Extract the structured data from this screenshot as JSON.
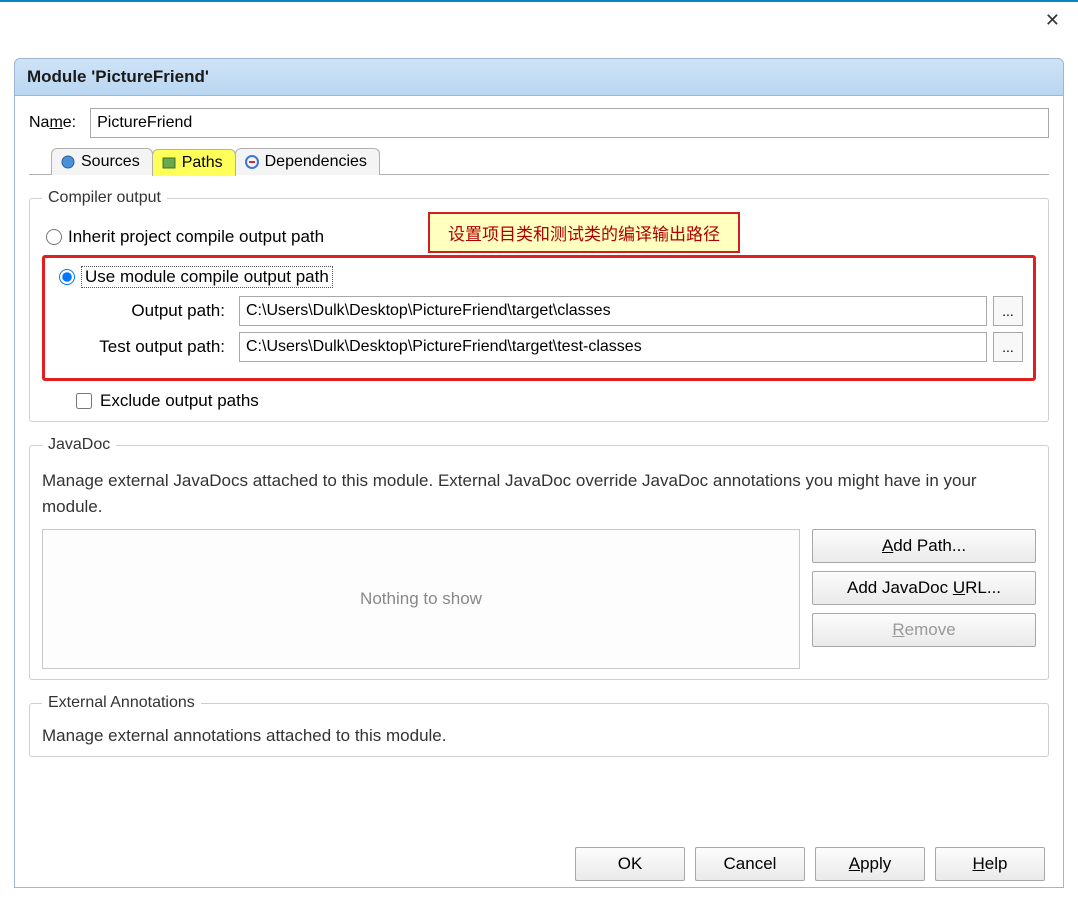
{
  "dialog": {
    "title": "Module 'PictureFriend'",
    "name_label_pre": "Na",
    "name_label_u": "m",
    "name_label_post": "e:",
    "name_value": "PictureFriend"
  },
  "tabs": {
    "sources": "Sources",
    "paths": "Paths",
    "dependencies": "Dependencies"
  },
  "compiler": {
    "legend": "Compiler output",
    "inherit_label": "Inherit project compile output path",
    "use_module_label": "Use module compile output path",
    "output_label": "Output path:",
    "output_value": "C:\\Users\\Dulk\\Desktop\\PictureFriend\\target\\classes",
    "test_label": "Test output path:",
    "test_value": "C:\\Users\\Dulk\\Desktop\\PictureFriend\\target\\test-classes",
    "browse": "...",
    "exclude_label": "Exclude output paths",
    "annotation": "设置项目类和测试类的编译输出路径"
  },
  "javadoc": {
    "legend": "JavaDoc",
    "body": "Manage external JavaDocs attached to this module. External JavaDoc override JavaDoc annotations you might have in your module.",
    "nothing": "Nothing to show",
    "add_path_pre": "",
    "add_path_u": "A",
    "add_path_post": "dd Path...",
    "add_url_pre": "Add JavaDoc ",
    "add_url_u": "U",
    "add_url_post": "RL...",
    "remove_pre": "",
    "remove_u": "R",
    "remove_post": "emove"
  },
  "external": {
    "legend": "External Annotations",
    "body": "Manage external annotations attached to this module."
  },
  "buttons": {
    "ok": "OK",
    "cancel": "Cancel",
    "apply_pre": "",
    "apply_u": "A",
    "apply_post": "pply",
    "help_pre": "",
    "help_u": "H",
    "help_post": "elp"
  }
}
